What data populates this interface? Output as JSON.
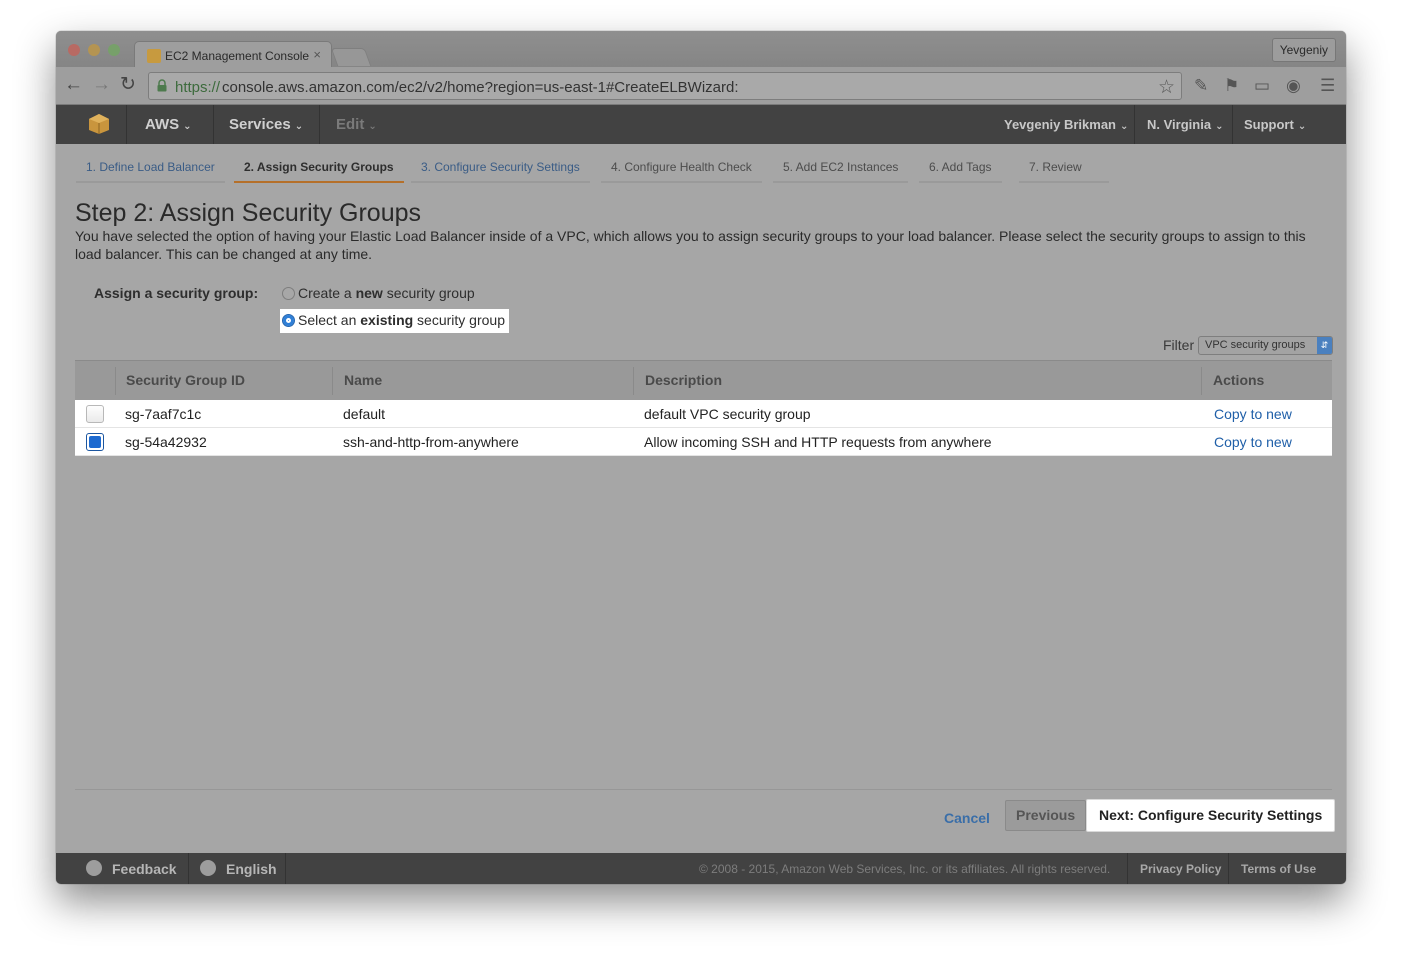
{
  "browser": {
    "tab_title": "EC2 Management Console",
    "tab_close": "×",
    "profile_name": "Yevgeniy",
    "url_scheme": "https://",
    "url_rest": "console.aws.amazon.com/ec2/v2/home?region=us-east-1#CreateELBWizard:"
  },
  "header": {
    "aws_label": "AWS",
    "services_label": "Services",
    "edit_label": "Edit",
    "user_label": "Yevgeniy Brikman",
    "region_label": "N. Virginia",
    "support_label": "Support"
  },
  "steps": [
    {
      "label": "1. Define Load Balancer"
    },
    {
      "label": "2. Assign Security Groups"
    },
    {
      "label": "3. Configure Security Settings"
    },
    {
      "label": "4. Configure Health Check"
    },
    {
      "label": "5. Add EC2 Instances"
    },
    {
      "label": "6. Add Tags"
    },
    {
      "label": "7. Review"
    }
  ],
  "page": {
    "title": "Step 2: Assign Security Groups",
    "intro": "You have selected the option of having your Elastic Load Balancer inside of a VPC, which allows you to assign security groups to your load balancer. Please select the security groups to assign to this load balancer. This can be changed at any time.",
    "assign_label": "Assign a security group:",
    "option_new_pre": "Create a ",
    "option_new_bold": "new",
    "option_new_post": " security group",
    "option_existing_pre": "Select an ",
    "option_existing_bold": "existing",
    "option_existing_post": " security group",
    "filter_label": "Filter",
    "filter_value": "VPC security groups"
  },
  "table": {
    "headers": {
      "id": "Security Group ID",
      "name": "Name",
      "description": "Description",
      "actions": "Actions"
    },
    "rows": [
      {
        "id": "sg-7aaf7c1c",
        "name": "default",
        "description": "default VPC security group",
        "action": "Copy to new",
        "checked": false
      },
      {
        "id": "sg-54a42932",
        "name": "ssh-and-http-from-anywhere",
        "description": "Allow incoming SSH and HTTP requests from anywhere",
        "action": "Copy to new",
        "checked": true
      }
    ]
  },
  "buttons": {
    "cancel": "Cancel",
    "previous": "Previous",
    "next": "Next: Configure Security Settings"
  },
  "footer": {
    "feedback": "Feedback",
    "language": "English",
    "copyright": "© 2008 - 2015, Amazon Web Services, Inc. or its affiliates. All rights reserved.",
    "privacy": "Privacy Policy",
    "terms": "Terms of Use"
  },
  "colors": {
    "accent_step": "#b5702a",
    "link": "#1f5fa8",
    "header_bg": "#424242"
  }
}
